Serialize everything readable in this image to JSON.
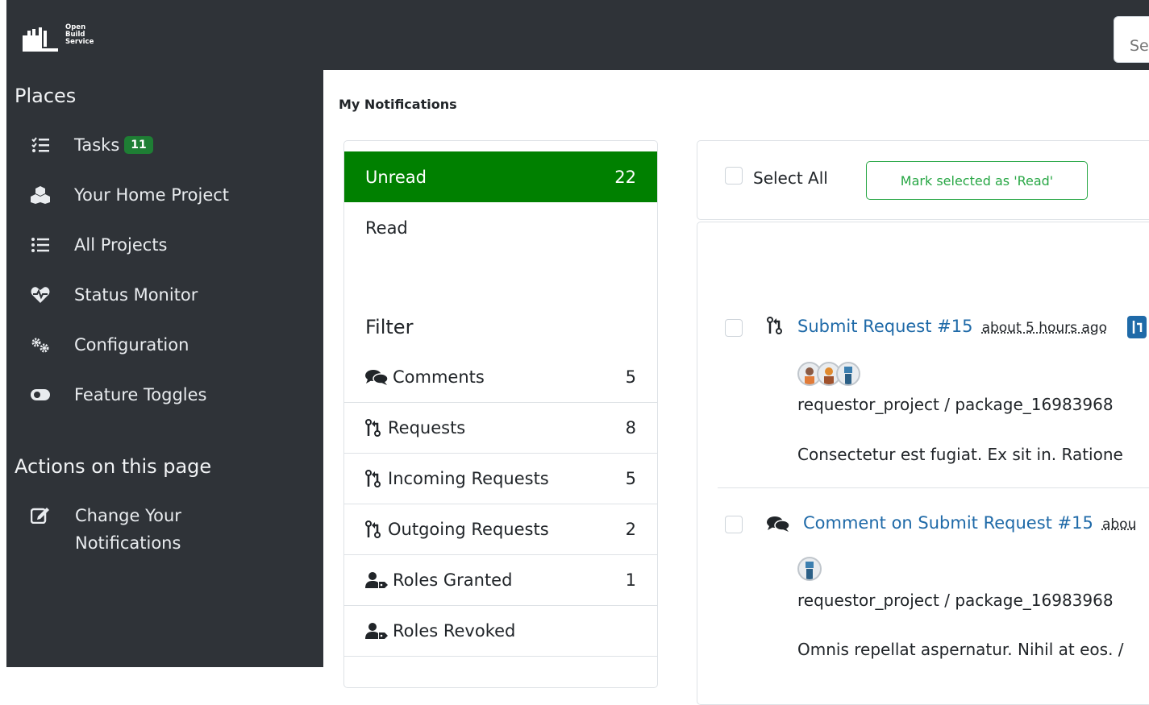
{
  "header": {
    "logo_lines": [
      "Open",
      "Build",
      "Service"
    ],
    "search_placeholder": "Se"
  },
  "sidebar": {
    "places_heading": "Places",
    "items": [
      {
        "label": "Tasks",
        "badge": "11",
        "icon": "tasks-icon"
      },
      {
        "label": "Your Home Project",
        "icon": "home-project-icon"
      },
      {
        "label": "All Projects",
        "icon": "list-icon"
      },
      {
        "label": "Status Monitor",
        "icon": "heartbeat-icon"
      },
      {
        "label": "Configuration",
        "icon": "cogs-icon"
      },
      {
        "label": "Feature Toggles",
        "icon": "toggle-icon"
      }
    ],
    "actions_heading": "Actions on this page",
    "change_notifications_label": "Change Your Notifications"
  },
  "main": {
    "title": "My Notifications",
    "states": [
      {
        "label": "Unread",
        "count": "22",
        "active": true
      },
      {
        "label": "Read",
        "count": ""
      }
    ],
    "filter_heading": "Filter",
    "filters": [
      {
        "label": "Comments",
        "count": "5",
        "icon": "comments-icon"
      },
      {
        "label": "Requests",
        "count": "8",
        "icon": "code-pull-request-icon"
      },
      {
        "label": "Incoming Requests",
        "count": "5",
        "icon": "code-pull-request-icon"
      },
      {
        "label": "Outgoing Requests",
        "count": "2",
        "icon": "code-pull-request-icon"
      },
      {
        "label": "Roles Granted",
        "count": "1",
        "icon": "user-tag-icon"
      },
      {
        "label": "Roles Revoked",
        "count": "",
        "icon": "user-tag-icon"
      }
    ],
    "select_all_label": "Select All",
    "mark_read_button": "Mark selected as 'Read'",
    "bracket_text": "[",
    "notifications": [
      {
        "title": "Submit Request #15",
        "time": "about 5 hours ago",
        "package": "requestor_project / package_16983968",
        "body": "Consectetur est fugiat. Ex sit in. Ratione"
      },
      {
        "title": "Comment on Submit Request #15",
        "time": "abou",
        "package": "requestor_project / package_16983968",
        "body": "Omnis repellat aspernatur. Nihil at eos. /"
      }
    ]
  },
  "colors": {
    "sidebar_bg": "#2f3338",
    "active_green": "#008000",
    "badge_green": "#1e7e34",
    "link_blue": "#1f6aa8",
    "button_green": "#28a745"
  }
}
